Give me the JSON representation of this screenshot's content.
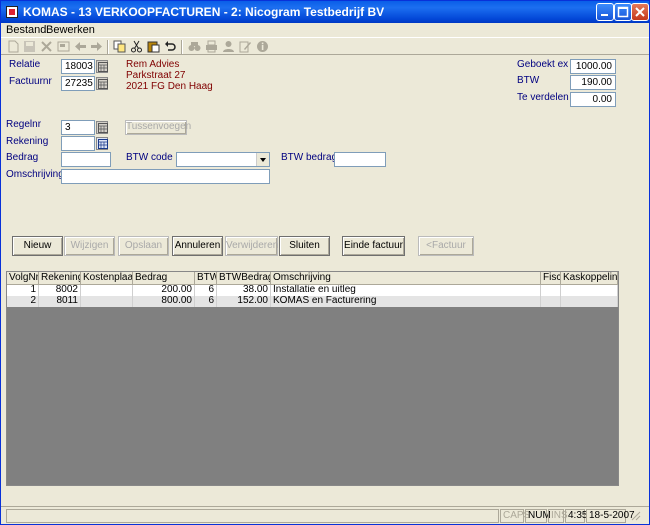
{
  "window": {
    "title": "KOMAS - 13 VERKOOPFACTUREN - 2: Nicogram Testbedrijf BV"
  },
  "menu": [
    {
      "label": "Bestand"
    },
    {
      "label": "Bewerken"
    }
  ],
  "toolbar_icons": [
    "new-doc-icon",
    "save-icon",
    "delete-icon",
    "record-icon",
    "back-arrow-icon",
    "forward-arrow-icon",
    "copy-icon",
    "cut-icon",
    "paste-icon",
    "undo-icon",
    "find-icon",
    "print-icon",
    "person-icon",
    "edit-icon",
    "info-icon"
  ],
  "header": {
    "relatie_label": "Relatie",
    "relatie_value": "18003",
    "factuurnr_label": "Factuurnr",
    "factuurnr_value": "27235",
    "address_line1": "Rem Advies",
    "address_line2": "Parkstraat 27",
    "address_line3": "2021 FG Den Haag",
    "geboekt_label": "Geboekt ex",
    "geboekt_value": "1000.00",
    "btw_label": "BTW",
    "btw_value": "190.00",
    "verdelen_label": "Te verdelen",
    "verdelen_value": "0.00"
  },
  "line": {
    "regelnr_label": "Regelnr",
    "regelnr_value": "3",
    "tussenvoegen_label": "Tussenvoegen",
    "rekening_label": "Rekening",
    "rekening_value": "",
    "bedrag_label": "Bedrag",
    "bedrag_value": "",
    "btwcode_label": "BTW code",
    "btwcode_value": "",
    "btwbedrag_label": "BTW bedrag",
    "btwbedrag_value": "",
    "omschrijving_label": "Omschrijving",
    "omschrijving_value": ""
  },
  "actions": {
    "nieuw": "Nieuw",
    "wijzigen": "Wijzigen",
    "opslaan": "Opslaan",
    "annuleren": "Annuleren",
    "verwijderen": "Verwijderen",
    "sluiten": "Sluiten",
    "einde": "Einde factuur",
    "vorige": "<Factuur"
  },
  "table": {
    "columns": [
      "VolgNr",
      "Rekening",
      "Kostenplaats",
      "Bedrag",
      "BTW",
      "BTWBedrag",
      "Omschrijving",
      "Fisc",
      "Kaskoppeling"
    ],
    "rows": [
      [
        "1",
        "8002",
        "",
        "200.00",
        "6",
        "38.00",
        "Installatie en uitleg",
        "",
        ""
      ],
      [
        "2",
        "8011",
        "",
        "800.00",
        "6",
        "152.00",
        "KOMAS en Facturering",
        "",
        ""
      ]
    ]
  },
  "status": {
    "caps": "CAPS",
    "num": "NUM",
    "ins": "INS",
    "time": "4:35",
    "date": "18-5-2007"
  },
  "colors": {
    "label": "#000080",
    "address": "#800000",
    "titlebar": "#0a5ee8",
    "grid_bg": "#808080"
  }
}
